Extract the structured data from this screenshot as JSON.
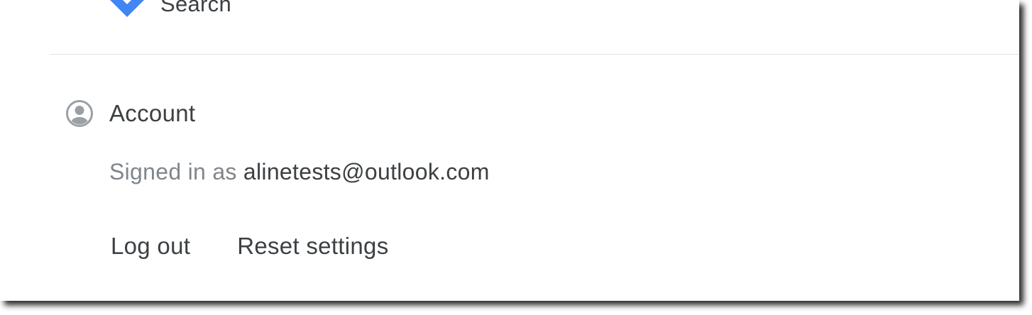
{
  "search": {
    "label": "Search",
    "icon": "search-diamond-icon",
    "icon_color": "#4285f4"
  },
  "account": {
    "title": "Account",
    "icon": "account-circle-icon",
    "icon_color": "#9aa0a6",
    "signed_in_prefix": "Signed in as",
    "email": "alinetests@outlook.com"
  },
  "actions": {
    "logout_label": "Log out",
    "reset_label": "Reset settings"
  }
}
